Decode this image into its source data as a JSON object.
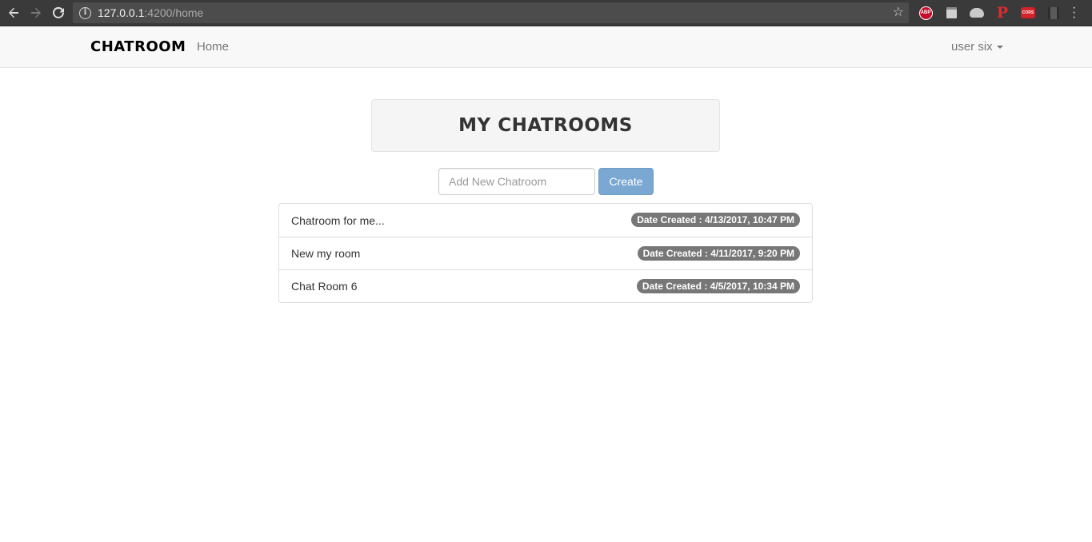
{
  "browser": {
    "url_host": "127.0.0.1",
    "url_path": ":4200/home",
    "extensions": [
      "abp-icon",
      "document-icon",
      "cloud-icon",
      "pinterest-icon",
      "cors-icon",
      "grid-icon"
    ]
  },
  "navbar": {
    "brand": "CHATROOM",
    "home_label": "Home",
    "user_label": "user six"
  },
  "main": {
    "title": "MY CHATROOMS",
    "new_chatroom_placeholder": "Add New Chatroom",
    "create_label": "Create",
    "chatrooms": [
      {
        "name": "Chatroom for me...",
        "date": "Date Created : 4/13/2017, 10:47 PM"
      },
      {
        "name": "New my room",
        "date": "Date Created : 4/11/2017, 9:20 PM"
      },
      {
        "name": "Chat Room 6",
        "date": "Date Created : 4/5/2017, 10:34 PM"
      }
    ]
  },
  "colors": {
    "create_button": "#7aa8d3",
    "badge": "#777777",
    "navbar_bg": "#f8f8f8",
    "chrome_bg": "#3a3a3a"
  }
}
